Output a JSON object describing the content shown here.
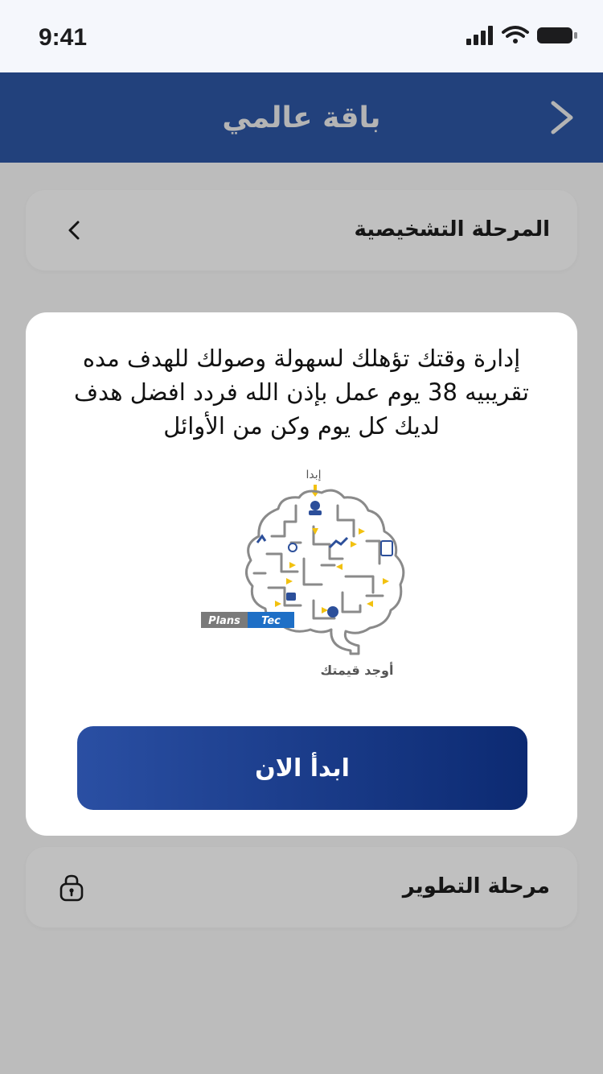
{
  "status_bar": {
    "time": "9:41"
  },
  "header": {
    "title": "باقة عالمي"
  },
  "stages": [
    {
      "label": "المرحلة التشخيصية",
      "state": "open",
      "icon": "chevron-left-icon"
    },
    {
      "label": "مرحلة التطوير",
      "state": "locked",
      "icon": "lock-icon"
    }
  ],
  "modal": {
    "message": "إدارة وقتك تؤهلك لسهولة وصولك للهدف مده\nتقريبيه 38 يوم عمل بإذن الله فردد افضل هدف\nلديك كل يوم وكن من الأوائل",
    "illustration": {
      "top_label": "إبدا",
      "bottom_label": "أوجد قيمتك",
      "logo_left": "Plans",
      "logo_right": "Tec"
    },
    "start_button": "ابدأ الان"
  },
  "colors": {
    "header": "#22417c",
    "button_start": "#2a4fa3",
    "button_end": "#0c2a72",
    "overlay": "#bcbcbc",
    "accent_yellow": "#f2c10f"
  }
}
